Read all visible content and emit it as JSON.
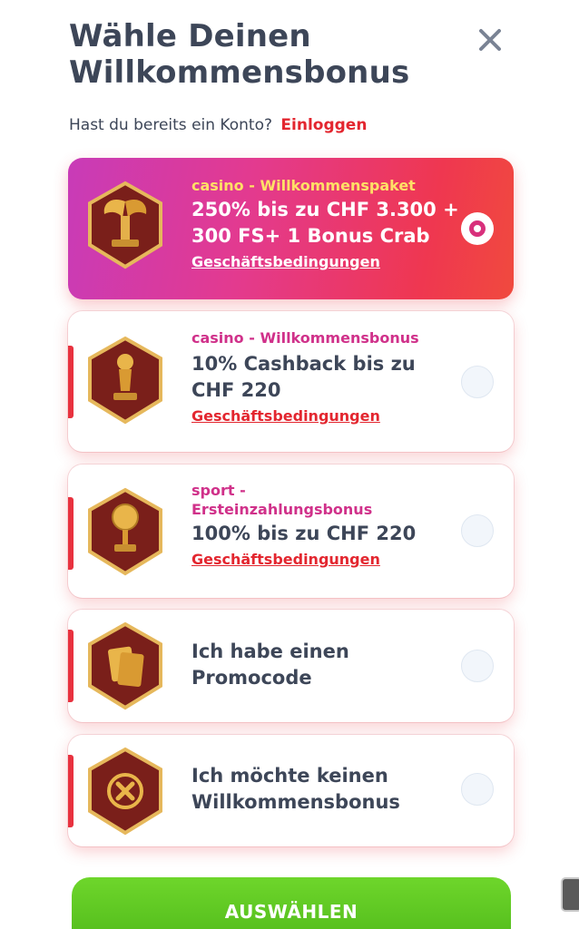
{
  "header": {
    "title": "Wähle Deinen Willkommensbonus",
    "login_prompt": "Hast du bereits ein Konto?",
    "login_link": "Einloggen",
    "close_icon": "close-icon"
  },
  "offers": [
    {
      "category": "casino - Willkommenspaket",
      "headline": "250% bis zu CHF 3.300 + 300 FS+ 1 Bonus Crab",
      "terms": "Geschäftsbedingungen",
      "icon": "winged-trophy-icon",
      "selected": true
    },
    {
      "category": "casino - Willkommensbonus",
      "headline": "10% Cashback bis zu CHF 220",
      "terms": "Geschäftsbedingungen",
      "icon": "statuette-trophy-icon",
      "selected": false
    },
    {
      "category": "sport - Ersteinzahlungsbonus",
      "headline": "100% bis zu CHF 220",
      "terms": "Geschäftsbedingungen",
      "icon": "football-trophy-icon",
      "selected": false
    },
    {
      "headline": "Ich habe einen Promocode",
      "icon": "promo-ticket-icon",
      "selected": false
    },
    {
      "headline": "Ich möchte keinen Willkommensbonus",
      "icon": "no-bonus-icon",
      "selected": false
    }
  ],
  "footer": {
    "submit_label": "AUSWÄHLEN"
  },
  "colors": {
    "accent_red": "#e3262f",
    "accent_pink": "#d0318a",
    "button_green": "#5cc722",
    "title_text": "#3d4658"
  }
}
